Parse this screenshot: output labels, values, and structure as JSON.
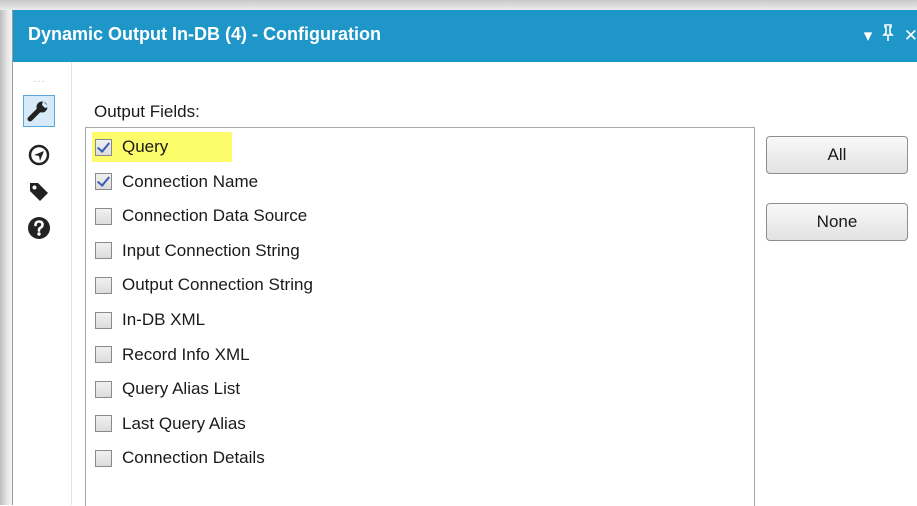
{
  "window": {
    "title": "Dynamic Output In-DB (4) - Configuration",
    "controls": {
      "dropdown": "▾",
      "pin": "⚑",
      "close": "✕"
    }
  },
  "toolstrip": {
    "grip": "···",
    "icons": [
      "wrench-icon",
      "navigate-icon",
      "tag-icon",
      "help-icon"
    ]
  },
  "output_fields": {
    "label": "Output Fields:",
    "items": [
      {
        "label": "Query",
        "checked": true,
        "highlighted": true
      },
      {
        "label": "Connection Name",
        "checked": true
      },
      {
        "label": "Connection Data Source",
        "checked": false
      },
      {
        "label": "Input Connection String",
        "checked": false
      },
      {
        "label": "Output Connection String",
        "checked": false
      },
      {
        "label": "In-DB XML",
        "checked": false
      },
      {
        "label": "Record Info XML",
        "checked": false
      },
      {
        "label": "Query Alias List",
        "checked": false
      },
      {
        "label": "Last Query Alias",
        "checked": false
      },
      {
        "label": "Connection Details",
        "checked": false
      }
    ]
  },
  "buttons": {
    "all": "All",
    "none": "None"
  },
  "colors": {
    "titlebar": "#1f96c8",
    "highlight": "#fdfc6a",
    "check": "#3a5bb5"
  }
}
